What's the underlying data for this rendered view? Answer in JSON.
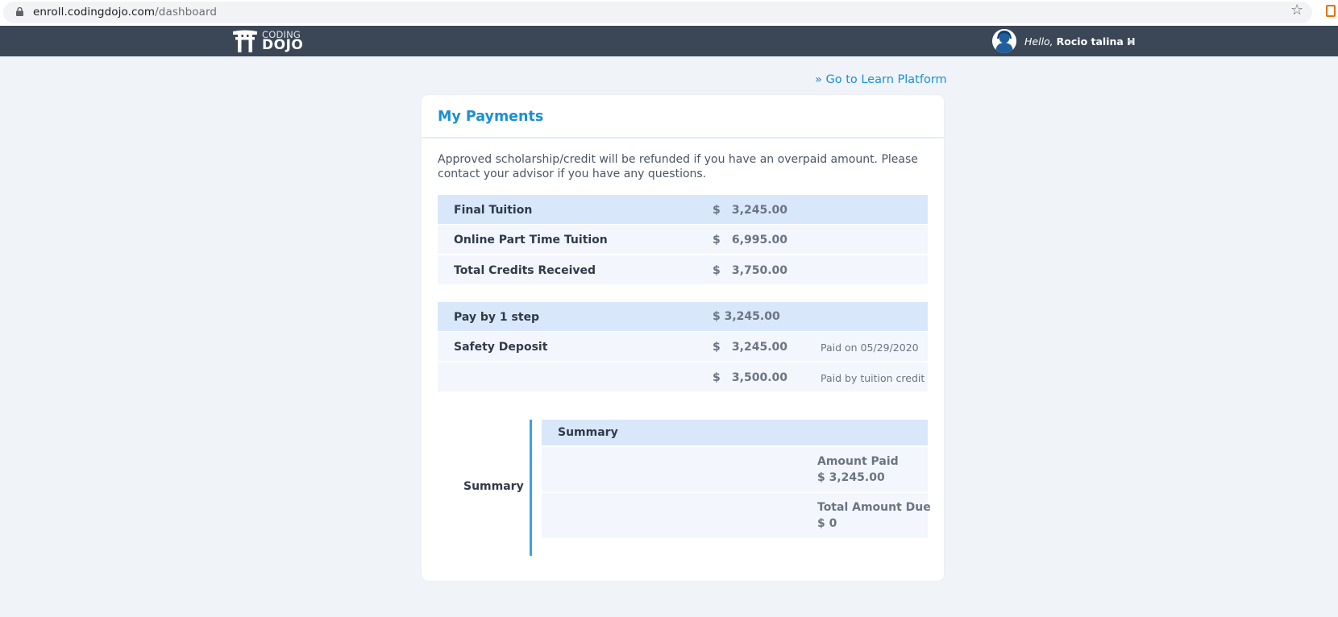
{
  "browser": {
    "url_domain": "enroll.codingdojo.com",
    "url_path": "/dashboard"
  },
  "header": {
    "logo_top": "CODING",
    "logo_bottom": "DOJO",
    "greeting": "Hello,",
    "user_name": "Rocio talina H"
  },
  "nav": {
    "learn_link": "» Go to Learn Platform"
  },
  "payments": {
    "title": "My Payments",
    "notice": "Approved scholarship/credit will be refunded if you have an overpaid amount. Please contact your advisor if you have any questions.",
    "tuition_rows": [
      {
        "label": "Final Tuition",
        "currency": "$",
        "amount": "3,245.00"
      },
      {
        "label": "Online Part Time Tuition",
        "currency": "$",
        "amount": "6,995.00"
      },
      {
        "label": "Total Credits Received",
        "currency": "$",
        "amount": "3,750.00"
      }
    ],
    "plan": {
      "label": "Pay by 1 step",
      "amount": "$ 3,245.00"
    },
    "payment_rows": [
      {
        "label": "Safety Deposit",
        "currency": "$",
        "amount": "3,245.00",
        "note": "Paid on 05/29/2020"
      },
      {
        "label": "",
        "currency": "$",
        "amount": "3,500.00",
        "note": "Paid by tuition credit"
      }
    ],
    "summary": {
      "side_label": "Summary",
      "header": "Summary",
      "amount_paid_label": "Amount Paid",
      "amount_paid_value": "$ 3,245.00",
      "total_due_label": "Total Amount Due",
      "total_due_value": "$ 0"
    }
  },
  "colors": {
    "nav_bg": "#3b4656",
    "accent": "#1a8fd6",
    "page_bg": "#f0f4f9",
    "row_highlight": "#d9e7fb",
    "row_light": "#f3f7fd"
  }
}
